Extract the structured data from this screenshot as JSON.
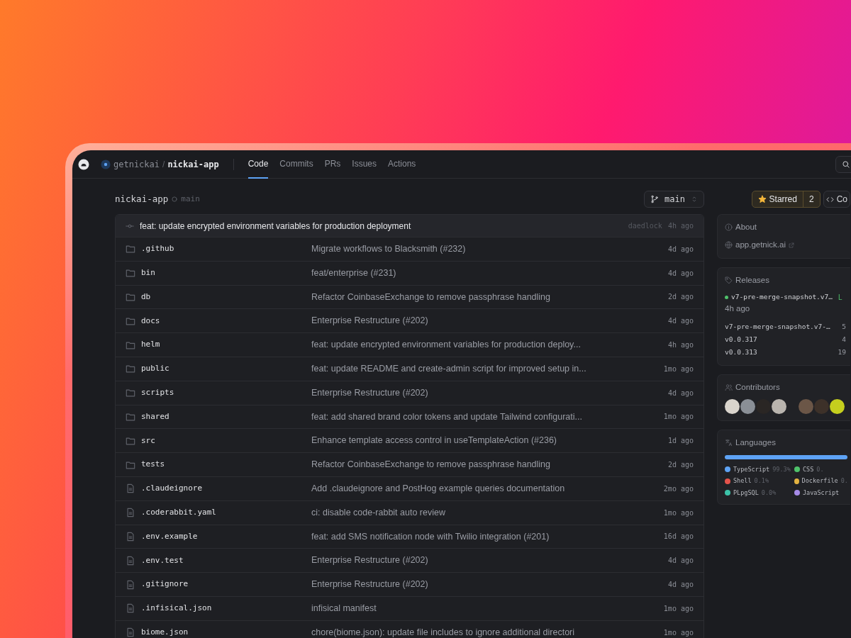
{
  "nav": {
    "owner": "getnickai",
    "separator": "/",
    "repo": "nickai-app",
    "tabs": [
      {
        "label": "Code",
        "selected": true
      },
      {
        "label": "Commits",
        "selected": false
      },
      {
        "label": "PRs",
        "selected": false
      },
      {
        "label": "Issues",
        "selected": false
      },
      {
        "label": "Actions",
        "selected": false
      }
    ]
  },
  "repo_header": {
    "name": "nickai-app",
    "branch": "main",
    "branch_button": "main",
    "star_button": "Starred",
    "star_count": "2",
    "starred": true,
    "code_button": "Co"
  },
  "latest_commit": {
    "message": "feat: update encrypted environment variables for production deployment",
    "author": "daedlock",
    "time": "4h ago"
  },
  "files": [
    {
      "kind": "folder",
      "name": ".github",
      "message": "Migrate workflows to Blacksmith (#232)",
      "time": "4d ago"
    },
    {
      "kind": "folder",
      "name": "bin",
      "message": "feat/enterprise (#231)",
      "time": "4d ago"
    },
    {
      "kind": "folder",
      "name": "db",
      "message": "Refactor CoinbaseExchange to remove passphrase handling",
      "time": "2d ago"
    },
    {
      "kind": "folder",
      "name": "docs",
      "message": "Enterprise Restructure (#202)",
      "time": "4d ago"
    },
    {
      "kind": "folder",
      "name": "helm",
      "message": "feat: update encrypted environment variables for production deploy...",
      "time": "4h ago"
    },
    {
      "kind": "folder",
      "name": "public",
      "message": "feat: update README and create-admin script for improved setup in...",
      "time": "1mo ago"
    },
    {
      "kind": "folder",
      "name": "scripts",
      "message": "Enterprise Restructure (#202)",
      "time": "4d ago"
    },
    {
      "kind": "folder",
      "name": "shared",
      "message": "feat: add shared brand color tokens and update Tailwind configurati...",
      "time": "1mo ago"
    },
    {
      "kind": "folder",
      "name": "src",
      "message": "Enhance template access control in useTemplateAction (#236)",
      "time": "1d ago"
    },
    {
      "kind": "folder",
      "name": "tests",
      "message": "Refactor CoinbaseExchange to remove passphrase handling",
      "time": "2d ago"
    },
    {
      "kind": "file",
      "name": ".claudeignore",
      "message": "Add .claudeignore and PostHog example queries documentation",
      "time": "2mo ago"
    },
    {
      "kind": "file",
      "name": ".coderabbit.yaml",
      "message": "ci: disable code-rabbit auto review",
      "time": "1mo ago"
    },
    {
      "kind": "file",
      "name": ".env.example",
      "message": "feat: add SMS notification node with Twilio integration (#201)",
      "time": "16d ago"
    },
    {
      "kind": "file",
      "name": ".env.test",
      "message": "Enterprise Restructure (#202)",
      "time": "4d ago"
    },
    {
      "kind": "file",
      "name": ".gitignore",
      "message": "Enterprise Restructure (#202)",
      "time": "4d ago"
    },
    {
      "kind": "file",
      "name": ".infisical.json",
      "message": "infisical manifest",
      "time": "1mo ago"
    },
    {
      "kind": "file",
      "name": "biome.json",
      "message": "chore(biome.json): update file includes to ignore additional directori",
      "time": "1mo ago"
    }
  ],
  "about": {
    "title": "About",
    "link": "app.getnick.ai"
  },
  "releases": {
    "title": "Releases",
    "latest": {
      "name": "v7-pre-merge-snapshot.v7…",
      "badge": "L",
      "time": "4h ago"
    },
    "items": [
      {
        "name": "v7-pre-merge-snapshot.v7-…",
        "time": "5"
      },
      {
        "name": "v0.0.317",
        "time": "4"
      },
      {
        "name": "v0.0.313",
        "time": "19"
      }
    ]
  },
  "contributors": {
    "title": "Contributors",
    "avatars": [
      {
        "color": "#d9d4cc"
      },
      {
        "color": "#8a8f96"
      },
      {
        "color": "#2a2624"
      },
      {
        "color": "#b9b4ae"
      },
      {
        "color": "#6b5647"
      },
      {
        "color": "#3d3129"
      },
      {
        "color": "#c5cf1e"
      }
    ]
  },
  "languages": {
    "title": "Languages",
    "items": [
      {
        "name": "TypeScript",
        "percent": "99.3%",
        "color": "#5ea3f5"
      },
      {
        "name": "CSS",
        "percent": "0.",
        "color": "#4fc26b"
      },
      {
        "name": "Shell",
        "percent": "0.1%",
        "color": "#e5534b"
      },
      {
        "name": "Dockerfile",
        "percent": "0.",
        "color": "#e3b341"
      },
      {
        "name": "PLpgSQL",
        "percent": "0.0%",
        "color": "#3cc2a8"
      },
      {
        "name": "JavaScript",
        "color": "#a68be8"
      }
    ]
  }
}
